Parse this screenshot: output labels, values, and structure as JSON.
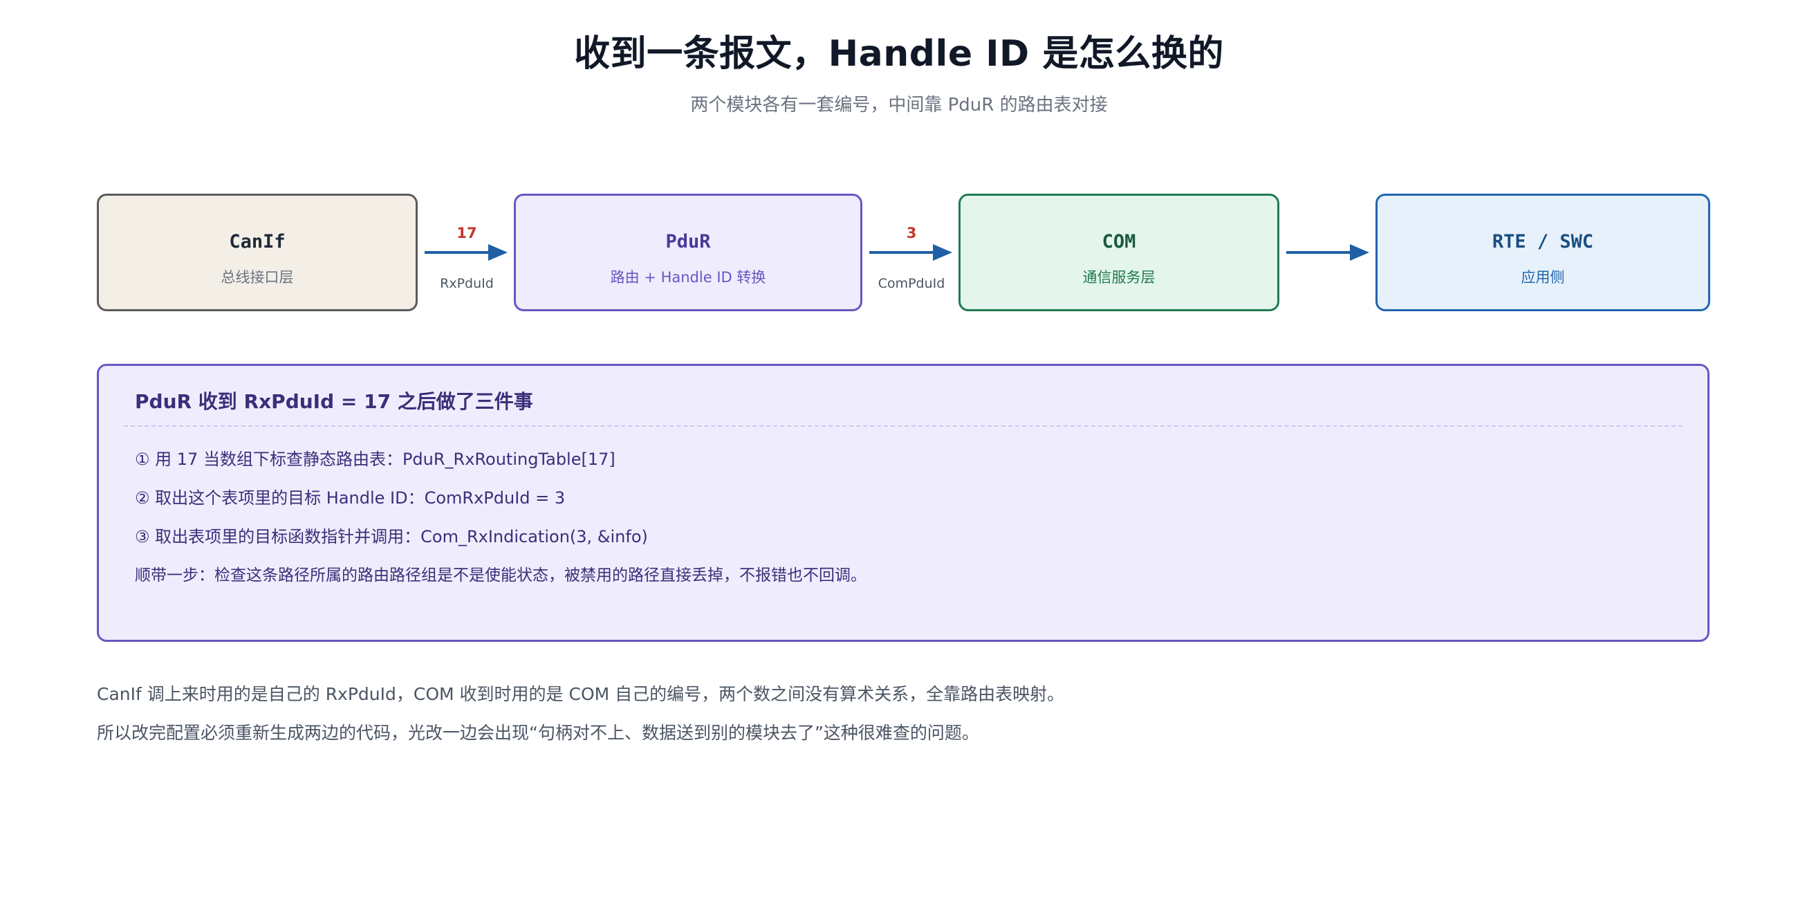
{
  "header": {
    "title": "收到一条报文，Handle ID 是怎么换的",
    "subtitle": "两个模块各有一套编号，中间靠 PduR 的路由表对接"
  },
  "flow": {
    "nodes": [
      {
        "title": "CanIf",
        "subtitle": "总线接口层"
      },
      {
        "title": "PduR",
        "subtitle": "路由 + Handle ID 转换"
      },
      {
        "title": "COM",
        "subtitle": "通信服务层"
      },
      {
        "title": "RTE / SWC",
        "subtitle": "应用侧"
      }
    ],
    "arrows": [
      {
        "value": "17",
        "label": "RxPduId"
      },
      {
        "value": "3",
        "label": "ComPduId"
      },
      {
        "value": "",
        "label": ""
      }
    ],
    "colors": {
      "arrow": "#1f5fa6",
      "value": "#c0392b"
    }
  },
  "panel": {
    "title": "PduR 收到 RxPduId = 17 之后做了三件事",
    "lines": [
      "① 用 17 当数组下标查静态路由表：PduR_RxRoutingTable[17]",
      "② 取出这个表项里的目标 Handle ID：ComRxPduId = 3",
      "③ 取出表项里的目标函数指针并调用：Com_RxIndication(3, &info)",
      "顺带一步：检查这条路径所属的路由路径组是不是使能状态，被禁用的路径直接丢掉，不报错也不回调。"
    ]
  },
  "notes": [
    "CanIf 调上来时用的是自己的 RxPduId，COM 收到时用的是 COM 自己的编号，两个数之间没有算术关系，全靠路由表映射。",
    "所以改完配置必须重新生成两边的代码，光改一边会出现“句柄对不上、数据送到别的模块去了”这种很难查的问题。"
  ]
}
